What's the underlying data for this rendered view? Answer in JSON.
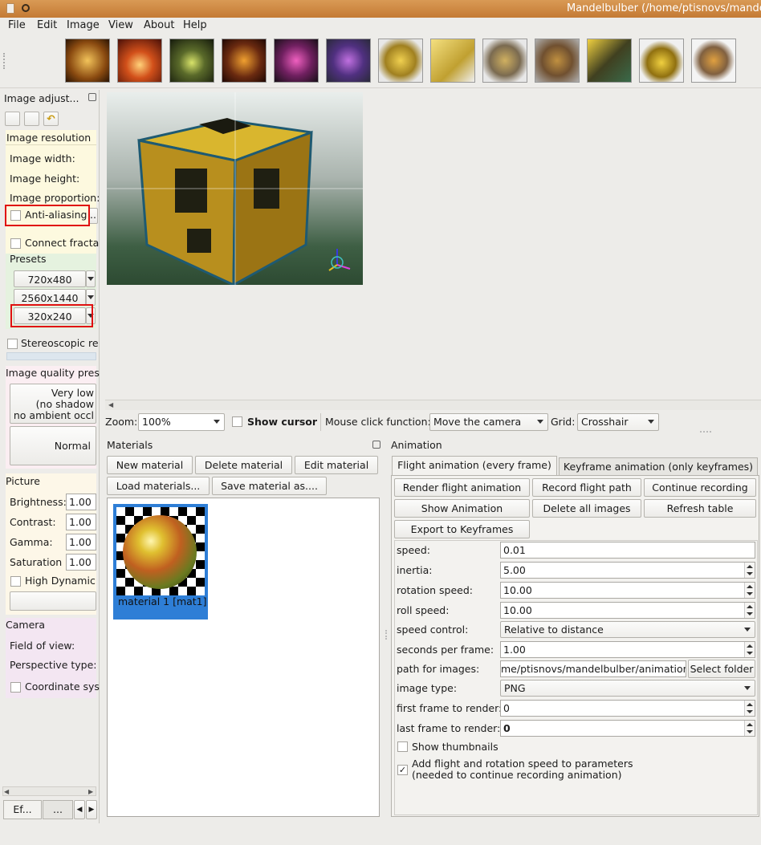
{
  "window": {
    "title": "Mandelbulber (/home/ptisnovs/mande"
  },
  "menu": [
    "File",
    "Edit",
    "Image",
    "View",
    "About",
    "Help"
  ],
  "toolbar": {
    "thumbnails": [
      "preset-1",
      "preset-2",
      "preset-3",
      "preset-4",
      "preset-5",
      "preset-6",
      "preset-7",
      "preset-8",
      "preset-9",
      "preset-10",
      "preset-11",
      "preset-12",
      "preset-13"
    ]
  },
  "left": {
    "dock_title": "Image adjust...",
    "resolution": {
      "header": "Image resolution",
      "width_label": "Image width:",
      "height_label": "Image height:",
      "proportion_label": "Image proportion:",
      "antialias_label": "Anti-aliasing",
      "antialias_more": "..",
      "connect_label": "Connect fracta",
      "presets_header": "Presets",
      "presets": [
        "720x480",
        "2560x1440",
        "320x240"
      ]
    },
    "stereo_label": "Stereoscopic re",
    "quality": {
      "header": "Image quality pres",
      "btn1_lines": [
        "Very low",
        "(no shadow",
        "no ambient occl"
      ],
      "btn2": "Normal"
    },
    "picture": {
      "header": "Picture",
      "brightness_label": "Brightness:",
      "brightness": "1.00",
      "contrast_label": "Contrast:",
      "contrast": "1.00",
      "gamma_label": "Gamma:",
      "gamma": "1.00",
      "saturation_label": "Saturation",
      "saturation": "1.00",
      "hdr_label": "High Dynamic"
    },
    "camera": {
      "header": "Camera",
      "fov_label": "Field of view:",
      "persp_label": "Perspective type:",
      "coord_label": "Coordinate sys"
    },
    "bottom_tabs": [
      "Ef...",
      "..."
    ]
  },
  "viewbar": {
    "zoom_label": "Zoom:",
    "zoom": "100%",
    "show_cursor": "Show cursor",
    "mouse_label": "Mouse click function:",
    "mouse_value": "Move the camera",
    "grid_label": "Grid:",
    "grid_value": "Crosshair"
  },
  "materials": {
    "title": "Materials",
    "new": "New material",
    "delete": "Delete material",
    "edit": "Edit material",
    "load": "Load materials...",
    "save": "Save material as....",
    "items": [
      {
        "label": "material 1 [mat1]"
      }
    ]
  },
  "animation": {
    "title": "Animation",
    "tabs": [
      "Flight animation (every frame)",
      "Keyframe animation (only keyframes)"
    ],
    "buttons": {
      "render": "Render flight animation",
      "record": "Record flight path",
      "continue": "Continue recording",
      "show": "Show Animation",
      "delete_all": "Delete all images",
      "refresh": "Refresh table",
      "export": "Export to Keyframes"
    },
    "params": {
      "speed_label": "speed:",
      "speed": "0.01",
      "inertia_label": "inertia:",
      "inertia": "5.00",
      "rotation_label": "rotation speed:",
      "rotation": "10.00",
      "roll_label": "roll speed:",
      "roll": "10.00",
      "control_label": "speed control:",
      "control": "Relative to distance",
      "spf_label": "seconds per frame:",
      "spf": "1.00",
      "path_label": "path for images:",
      "path": "me/ptisnovs/mandelbulber/animation/",
      "select_folder": "Select folder",
      "type_label": "image type:",
      "type": "PNG",
      "first_label": "first frame to render:",
      "first": "0",
      "last_label": "last frame to render:",
      "last": "0"
    },
    "show_thumbs": "Show thumbnails",
    "add_speed_lines": [
      "Add flight and rotation speed to parameters",
      "(needed to continue recording animation)"
    ]
  }
}
